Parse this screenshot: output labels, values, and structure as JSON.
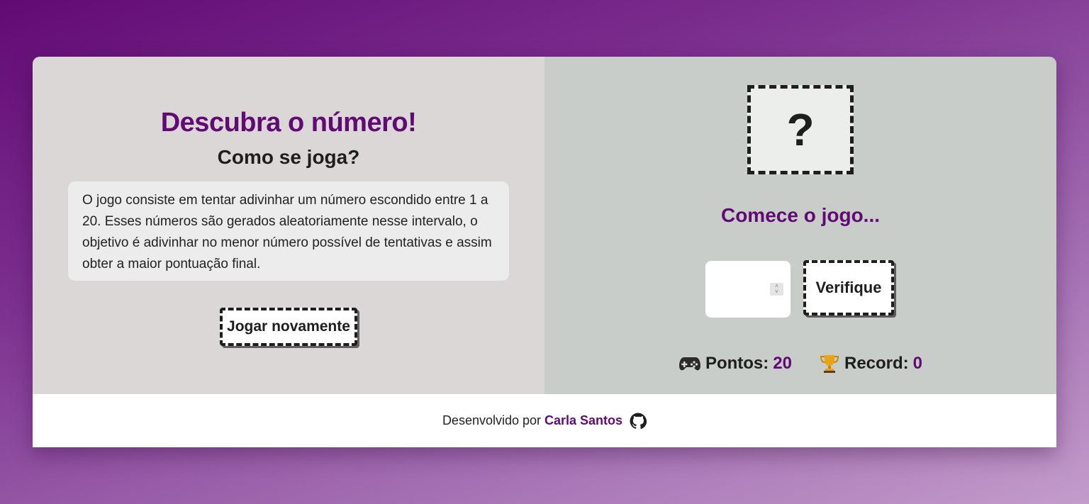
{
  "game": {
    "title": "Descubra o número!",
    "subtitle": "Como se joga?",
    "rules": "O jogo consiste em tentar adivinhar um número escondido entre 1 a 20. Esses números são gerados aleatoriamente nesse intervalo, o objetivo é adivinhar no menor número possível de tentativas e assim obter a maior pontuação final.",
    "restart_label": "Jogar novamente",
    "secret_number": "?",
    "status_message": "Comece o jogo...",
    "guess_value": "",
    "check_label": "Verifique",
    "score_label": "Pontos:",
    "score_value": "20",
    "record_label": "Record:",
    "record_value": "0"
  },
  "icons": {
    "score": "gamepad-icon",
    "record": "trophy-icon",
    "footer": "github-icon"
  },
  "colors": {
    "accent": "#620a74",
    "left_panel": "#dbd7d7",
    "right_panel": "#c9cdca"
  },
  "footer": {
    "prefix": "Desenvolvido por",
    "author": "Carla Santos"
  }
}
